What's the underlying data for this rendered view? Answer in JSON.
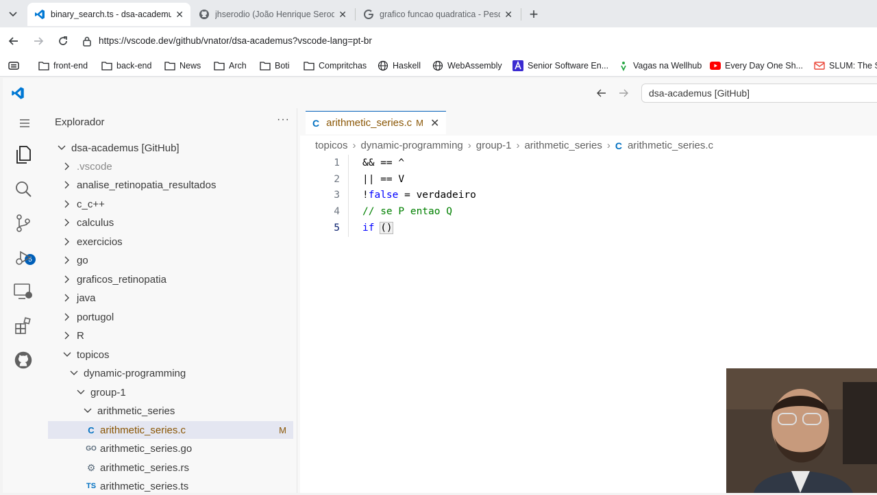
{
  "browser": {
    "tabs": [
      {
        "title": "binary_search.ts - dsa-academus [G",
        "icon": "vscode-icon",
        "active": true
      },
      {
        "title": "jhserodio (João Henrique Serodio)",
        "icon": "github-icon",
        "active": false
      },
      {
        "title": "grafico funcao quadratica - Pesqu",
        "icon": "google-icon",
        "active": false
      }
    ],
    "url": "https://vscode.dev/github/vnator/dsa-academus?vscode-lang=pt-br",
    "bookmarks": [
      {
        "label": "front-end",
        "icon": "folder-icon"
      },
      {
        "label": "back-end",
        "icon": "folder-icon"
      },
      {
        "label": "News",
        "icon": "folder-icon"
      },
      {
        "label": "Arch",
        "icon": "folder-icon"
      },
      {
        "label": "Boti",
        "icon": "folder-icon"
      },
      {
        "label": "Compritchas",
        "icon": "folder-icon"
      },
      {
        "label": "Haskell",
        "icon": "globe-icon"
      },
      {
        "label": "WebAssembly",
        "icon": "globe-icon"
      },
      {
        "label": "Senior Software En...",
        "icon": "a-logo-icon"
      },
      {
        "label": "Vagas na Wellhub",
        "icon": "wellhub-icon"
      },
      {
        "label": "Every Day One Sh...",
        "icon": "youtube-icon"
      },
      {
        "label": "SLUM: The Sh",
        "icon": "gmail-icon"
      }
    ]
  },
  "vscode": {
    "command_center": "dsa-academus [GitHub]",
    "scm_badge": "5",
    "explorer": {
      "title": "Explorador",
      "root": "dsa-academus [GitHub]",
      "items": [
        {
          "label": ".vscode",
          "kind": "folder",
          "open": false
        },
        {
          "label": "analise_retinopatia_resultados",
          "kind": "folder",
          "open": false
        },
        {
          "label": "c_c++",
          "kind": "folder",
          "open": false
        },
        {
          "label": "calculus",
          "kind": "folder",
          "open": false
        },
        {
          "label": "exercicios",
          "kind": "folder",
          "open": false
        },
        {
          "label": "go",
          "kind": "folder",
          "open": false
        },
        {
          "label": "graficos_retinopatia",
          "kind": "folder",
          "open": false
        },
        {
          "label": "java",
          "kind": "folder",
          "open": false
        },
        {
          "label": "portugol",
          "kind": "folder",
          "open": false
        },
        {
          "label": "R",
          "kind": "folder",
          "open": false
        },
        {
          "label": "topicos",
          "kind": "folder",
          "open": true
        },
        {
          "label": "dynamic-programming",
          "kind": "folder",
          "open": true
        },
        {
          "label": "group-1",
          "kind": "folder",
          "open": true
        },
        {
          "label": "arithmetic_series",
          "kind": "folder",
          "open": true
        },
        {
          "label": "arithmetic_series.c",
          "kind": "file",
          "icon_text": "C",
          "status": "M"
        },
        {
          "label": "arithmetic_series.go",
          "kind": "file",
          "icon_text": "GO"
        },
        {
          "label": "arithmetic_series.rs",
          "kind": "file",
          "icon_text": "⚙"
        },
        {
          "label": "arithmetic_series.ts",
          "kind": "file",
          "icon_text": "TS"
        }
      ]
    },
    "editor": {
      "tab": {
        "icon_text": "C",
        "label": "arithmetic_series.c",
        "status": "M"
      },
      "breadcrumbs": [
        "topicos",
        "dynamic-programming",
        "group-1",
        "arithmetic_series",
        "arithmetic_series.c"
      ],
      "lines": [
        {
          "n": "1",
          "text": "&& == ^"
        },
        {
          "n": "2",
          "text": "|| == V"
        },
        {
          "n": "3",
          "text_op": "!",
          "text_kw": "false",
          "text_rest": " = verdadeiro"
        },
        {
          "n": "4",
          "comment": "// se P entao Q"
        },
        {
          "n": "5",
          "kw": "if",
          "rest": " ",
          "paren": "()"
        }
      ]
    }
  },
  "colors": {
    "accent": "#005fb8",
    "modified": "#895503",
    "keyword": "#0000ff",
    "comment": "#008000"
  }
}
